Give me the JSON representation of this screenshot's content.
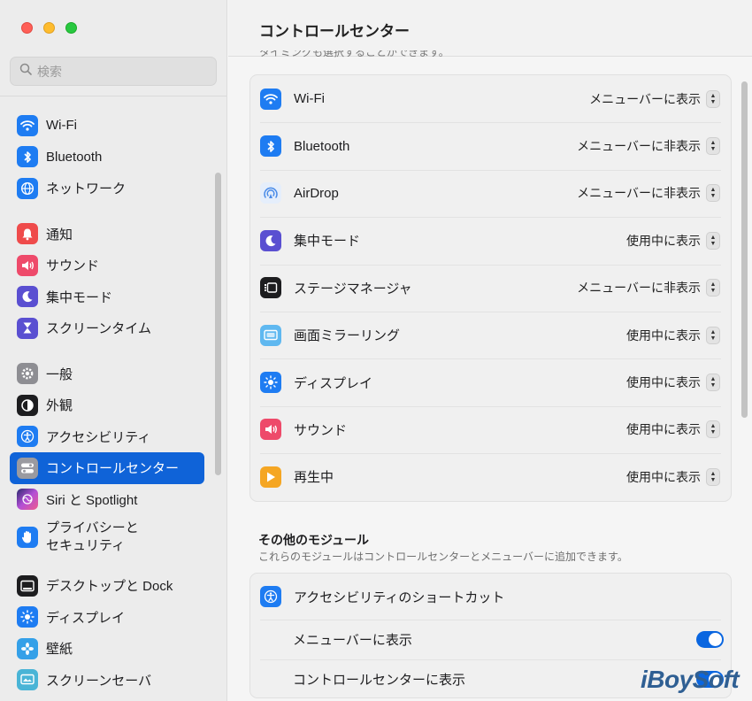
{
  "window": {
    "title": "コントロールセンター"
  },
  "colors": {
    "accent": "#0f63d8",
    "toggle_on": "#0a66e0"
  },
  "search": {
    "placeholder": "検索"
  },
  "sidebar": {
    "items": [
      {
        "label": "Wi-Fi",
        "icon": "wifi-icon",
        "color": "#1e7cf2"
      },
      {
        "label": "Bluetooth",
        "icon": "bluetooth-icon",
        "color": "#1e7cf2"
      },
      {
        "label": "ネットワーク",
        "icon": "globe-icon",
        "color": "#1e7cf2"
      },
      {
        "label": "通知",
        "icon": "bell-icon",
        "color": "#ef4b4b"
      },
      {
        "label": "サウンド",
        "icon": "speaker-icon",
        "color": "#ee4a6a"
      },
      {
        "label": "集中モード",
        "icon": "moon-icon",
        "color": "#5a4fd1"
      },
      {
        "label": "スクリーンタイム",
        "icon": "hourglass-icon",
        "color": "#5a4fd1"
      },
      {
        "label": "一般",
        "icon": "gear-icon",
        "color": "#8e8e93"
      },
      {
        "label": "外観",
        "icon": "appearance-icon",
        "color": "#1d1d1f"
      },
      {
        "label": "アクセシビリティ",
        "icon": "accessibility-icon",
        "color": "#1e7cf2"
      },
      {
        "label": "コントロールセンター",
        "icon": "control-center-icon",
        "color": "#8e8e93"
      },
      {
        "label": "Siri と Spotlight",
        "icon": "siri-icon",
        "color": "#b34fd6"
      },
      {
        "label_line1": "プライバシーと",
        "label_line2": "セキュリティ",
        "icon": "hand-icon",
        "color": "#1e7cf2"
      },
      {
        "label": "デスクトップと Dock",
        "icon": "dock-icon",
        "color": "#1d1d1f"
      },
      {
        "label": "ディスプレイ",
        "icon": "display-icon",
        "color": "#1e7cf2"
      },
      {
        "label": "壁紙",
        "icon": "wallpaper-icon",
        "color": "#34a0e8"
      },
      {
        "label": "スクリーンセーバ",
        "icon": "screensaver-icon",
        "color": "#49b4d6"
      }
    ]
  },
  "main": {
    "cut_text": "タイミングも選択することができます。",
    "modules": [
      {
        "label": "Wi-Fi",
        "value": "メニューバーに表示",
        "icon": "wifi-icon",
        "color": "#1e7cf2"
      },
      {
        "label": "Bluetooth",
        "value": "メニューバーに非表示",
        "icon": "bluetooth-icon",
        "color": "#1e7cf2"
      },
      {
        "label": "AirDrop",
        "value": "メニューバーに非表示",
        "icon": "airdrop-icon",
        "color": "#e5eefb"
      },
      {
        "label": "集中モード",
        "value": "使用中に表示",
        "icon": "moon-icon",
        "color": "#5a4fd1"
      },
      {
        "label": "ステージマネージャ",
        "value": "メニューバーに非表示",
        "icon": "stage-manager-icon",
        "color": "#1d1d1f"
      },
      {
        "label": "画面ミラーリング",
        "value": "使用中に表示",
        "icon": "screen-mirroring-icon",
        "color": "#5fb8f0"
      },
      {
        "label": "ディスプレイ",
        "value": "使用中に表示",
        "icon": "brightness-icon",
        "color": "#1e7cf2"
      },
      {
        "label": "サウンド",
        "value": "使用中に表示",
        "icon": "speaker-icon",
        "color": "#ee4a6a"
      },
      {
        "label": "再生中",
        "value": "使用中に表示",
        "icon": "play-icon",
        "color": "#f5a623"
      }
    ],
    "other": {
      "title": "その他のモジュール",
      "desc": "これらのモジュールはコントロールセンターとメニューバーに追加できます。",
      "shortcut_label": "アクセシビリティのショートカット",
      "menubar_label": "メニューバーに表示",
      "cc_label": "コントロールセンターに表示"
    }
  },
  "watermark": "iBoySoft"
}
